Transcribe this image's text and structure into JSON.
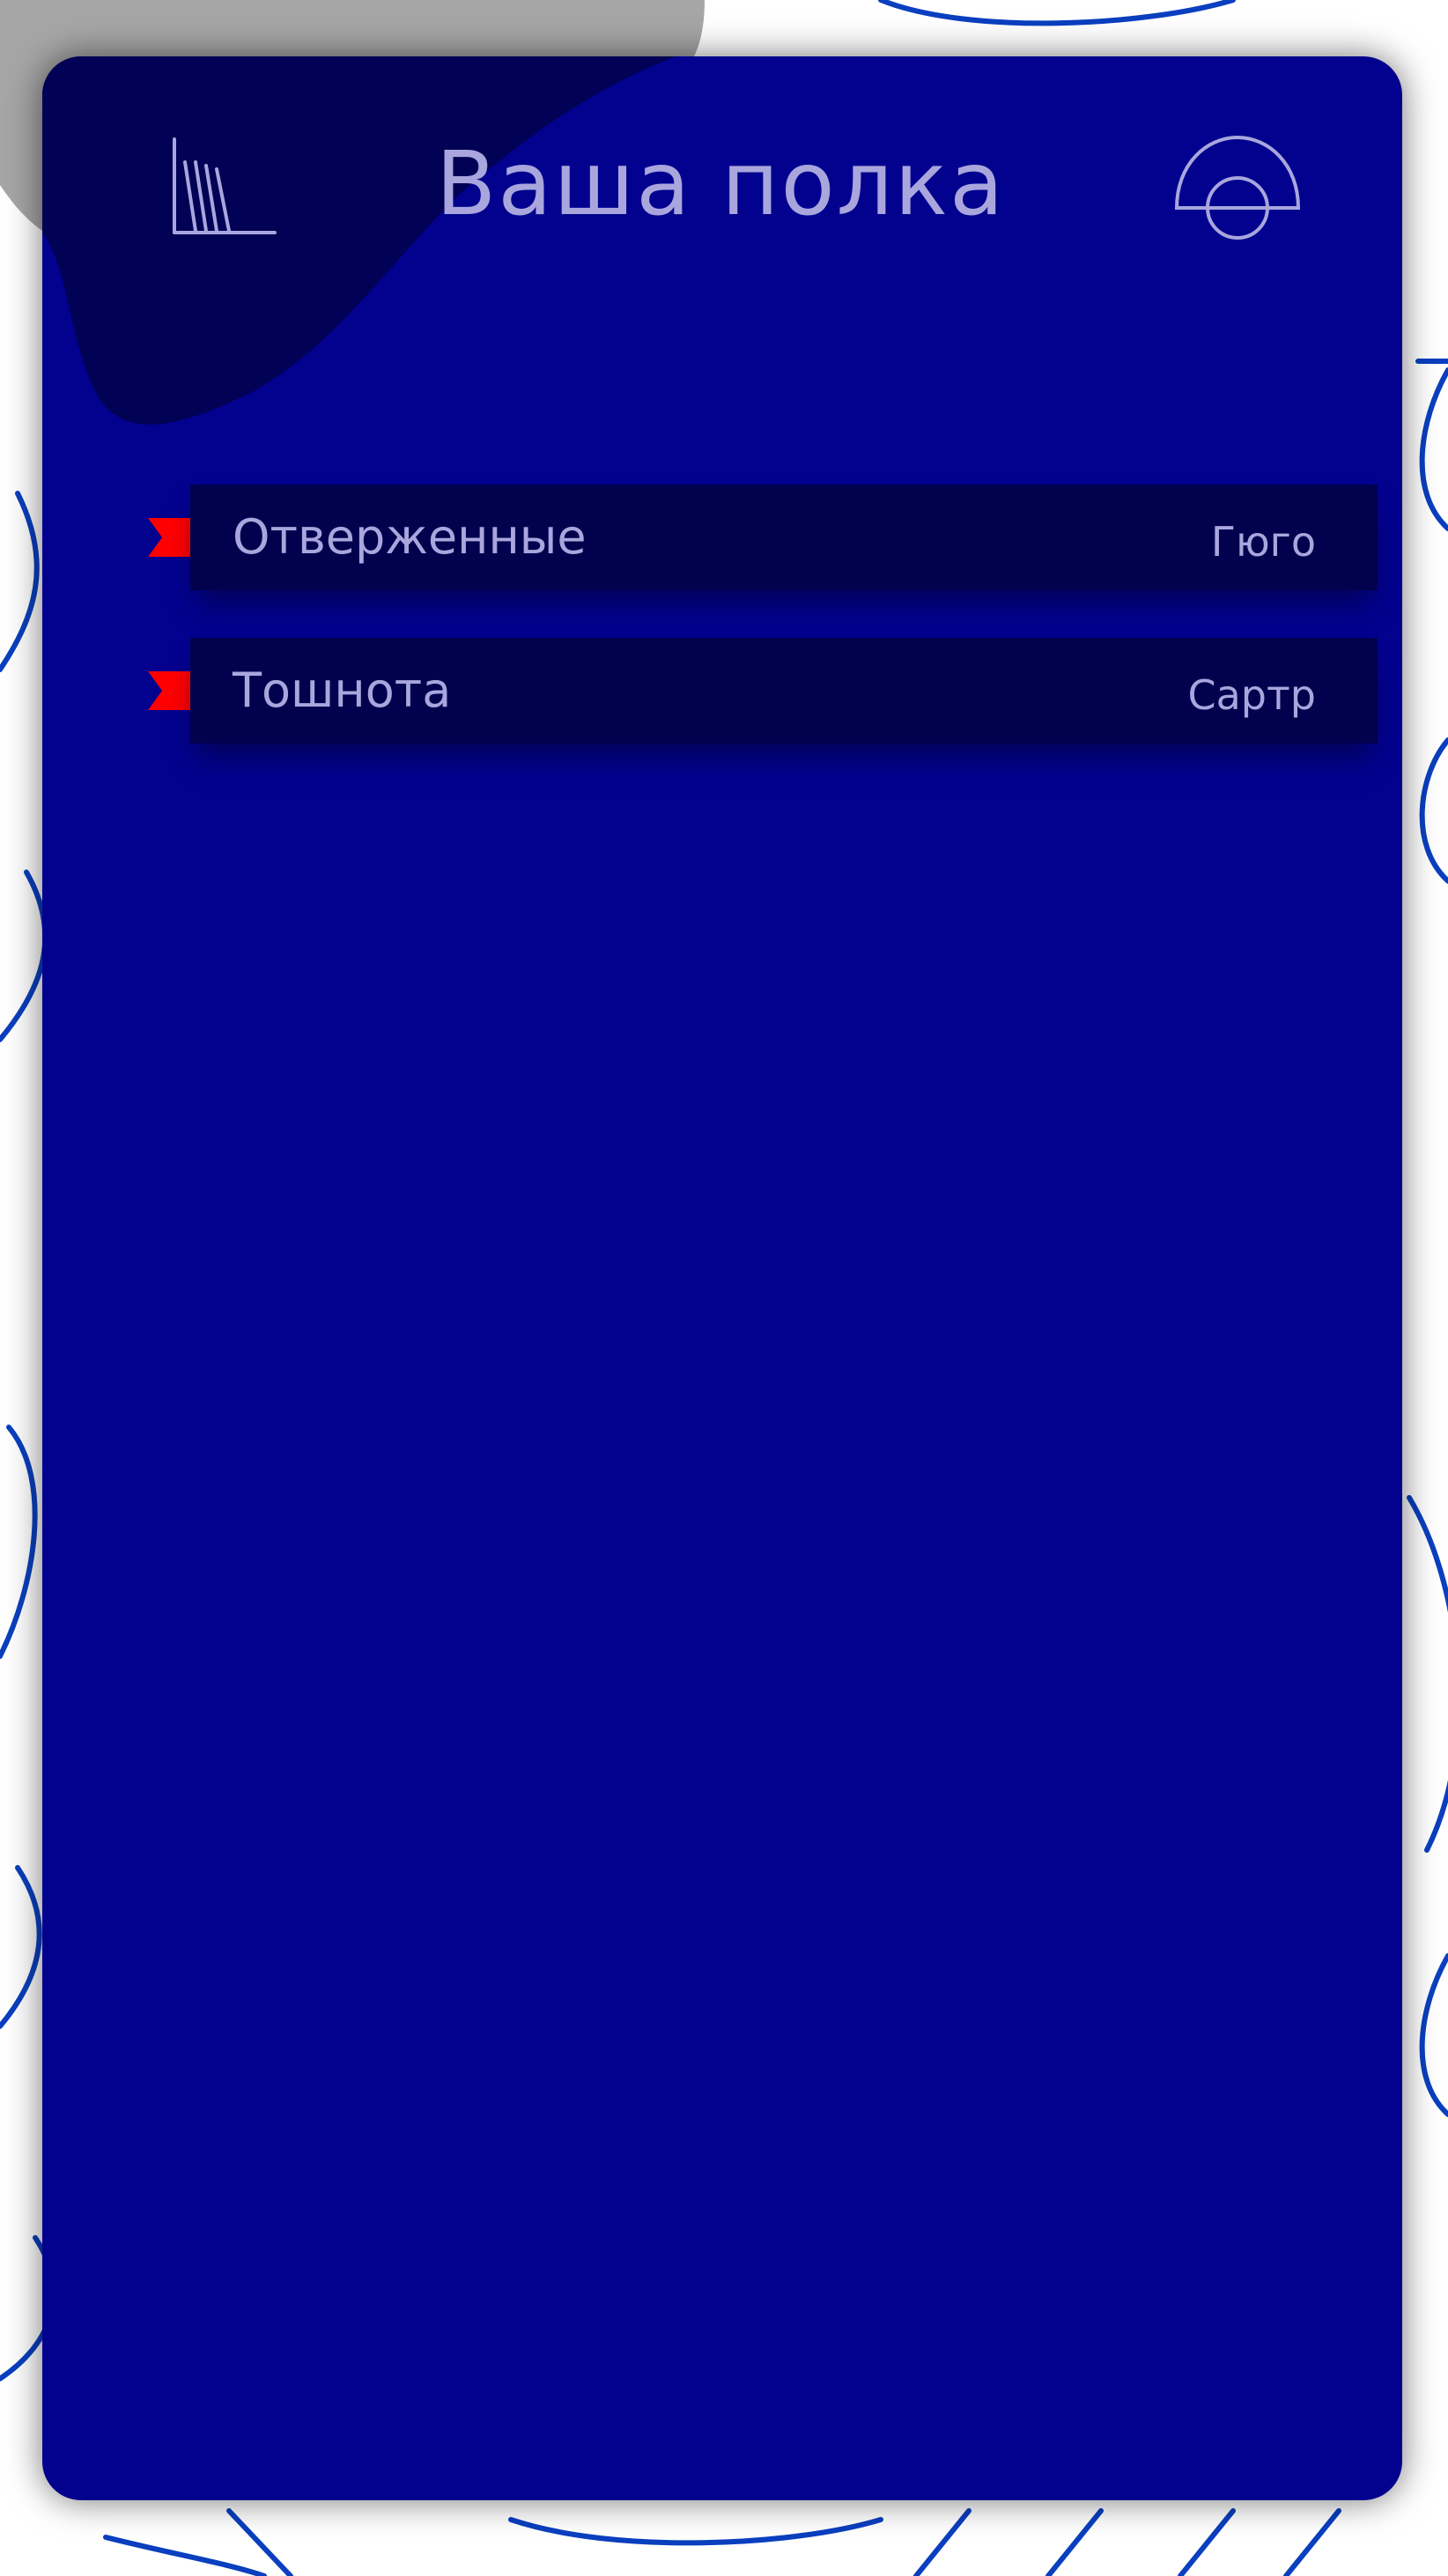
{
  "header": {
    "title": "Ваша полка",
    "left_icon": "bookshelf-icon",
    "right_icon": "profile-icon"
  },
  "books": [
    {
      "title": "Отверженные",
      "author": "Гюго",
      "marker_icon": "bookmark-ribbon-icon"
    },
    {
      "title": "Тошнота",
      "author": "Сартр",
      "marker_icon": "bookmark-ribbon-icon"
    }
  ],
  "colors": {
    "page_background": "#ffffff",
    "pattern_lines": "#0a3fbf",
    "card_background": "#02028f",
    "blob": "#010155",
    "row_background": "#01014e",
    "text": "#a9a6dd",
    "ribbon": "#ff0000"
  }
}
